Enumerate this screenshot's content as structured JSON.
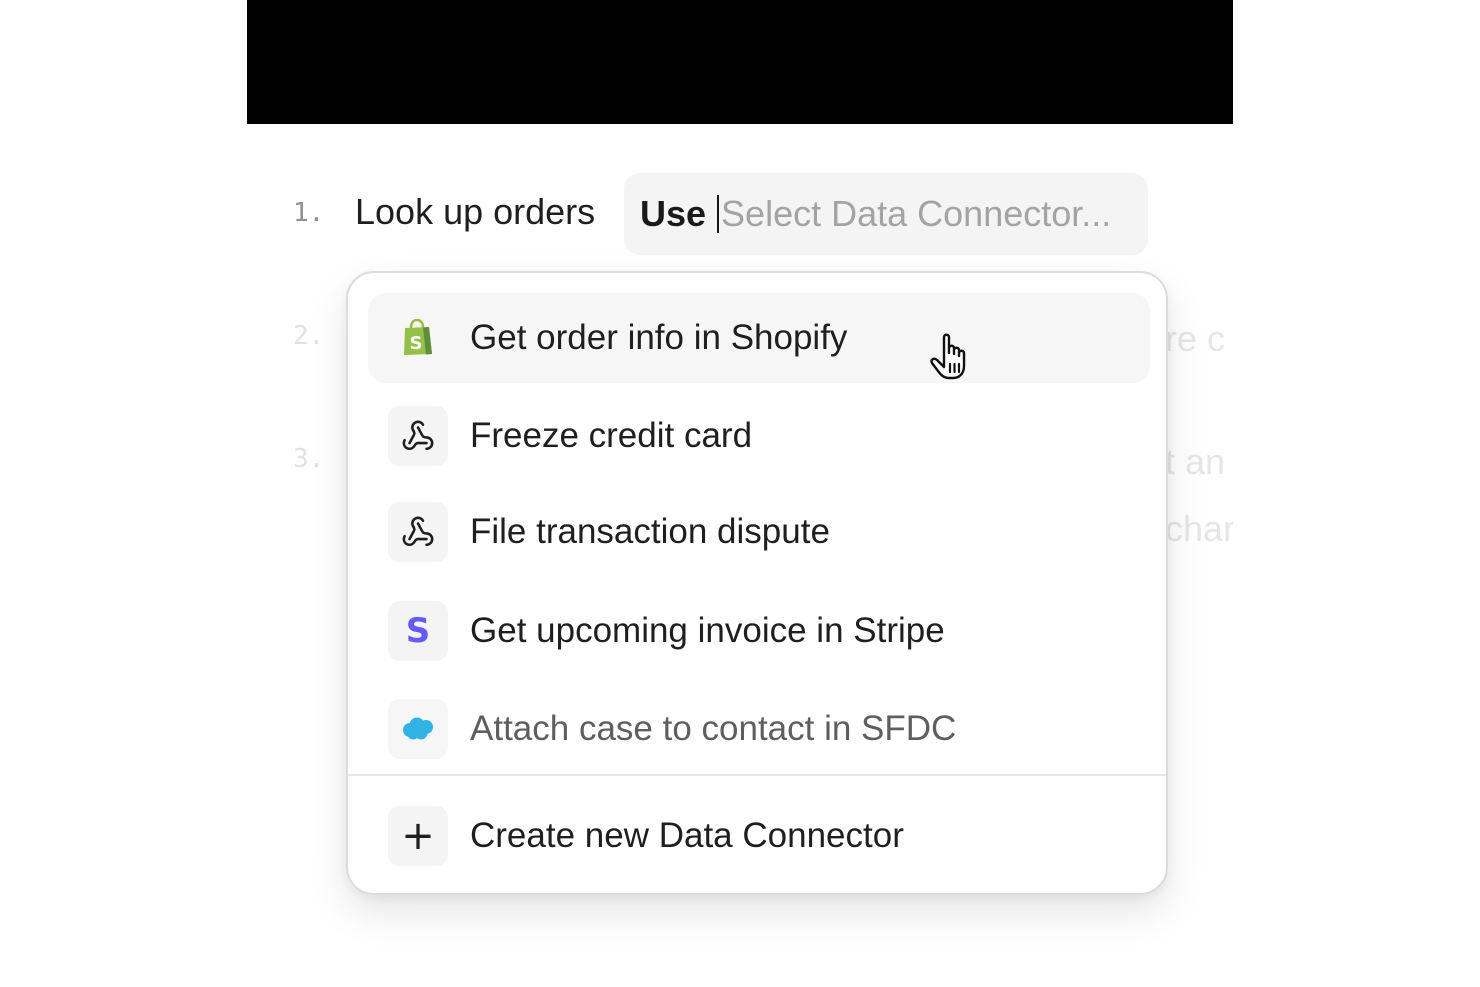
{
  "steps": [
    {
      "number": "1.",
      "text": "Look up orders"
    },
    {
      "number": "2.",
      "ghost_text": "re c"
    },
    {
      "number": "3.",
      "ghost_text": "t an",
      "ghost_text_2": "char"
    }
  ],
  "chip": {
    "use_label": "Use",
    "placeholder": "Select Data Connector..."
  },
  "dropdown": {
    "options": [
      {
        "label": "Get order info in Shopify",
        "icon": "shopify-icon",
        "state": "hovered"
      },
      {
        "label": "Freeze credit card",
        "icon": "webhook-icon"
      },
      {
        "label": "File transaction dispute",
        "icon": "webhook-icon"
      },
      {
        "label": "Get upcoming invoice in Stripe",
        "icon": "stripe-icon",
        "icon_glyph": "S"
      },
      {
        "label": "Attach case to contact in SFDC",
        "icon": "salesforce-icon",
        "state": "partially-visible"
      }
    ],
    "create": {
      "label": "Create new Data Connector",
      "icon": "plus-icon",
      "icon_glyph": "+"
    }
  },
  "colors": {
    "shopify_green": "#95bf47",
    "stripe_purple": "#635bff",
    "salesforce_blue": "#00a1e0"
  }
}
